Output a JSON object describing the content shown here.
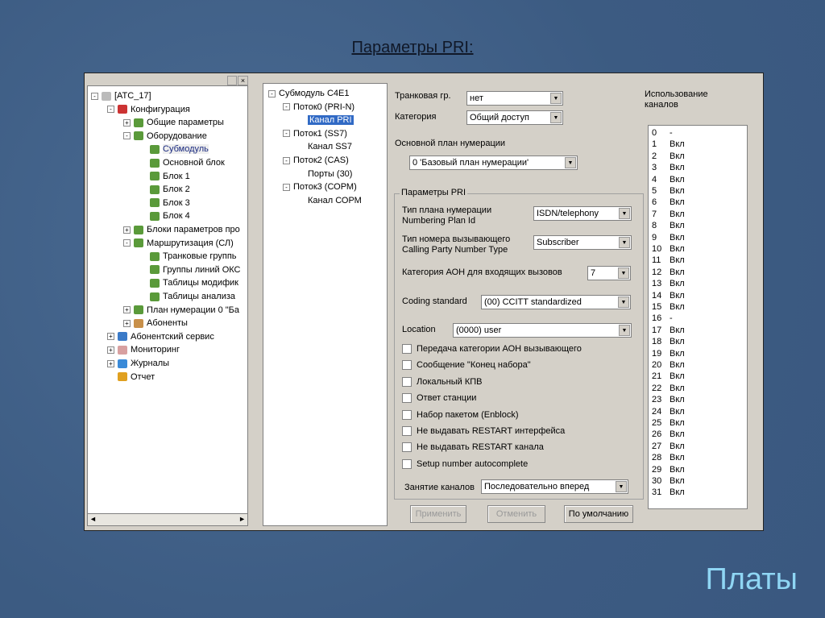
{
  "slide": {
    "title": "Параметры PRI:",
    "footer": "Платы"
  },
  "left_tree": [
    {
      "label": "[АТС_17]",
      "level": 0,
      "exp": "-",
      "icon": "phone-icon"
    },
    {
      "label": "Конфигурация",
      "level": 1,
      "exp": "-",
      "icon": "tools-icon"
    },
    {
      "label": "Общие параметры",
      "level": 2,
      "exp": "+",
      "icon": "check-icon"
    },
    {
      "label": "Оборудование",
      "level": 2,
      "exp": "-",
      "icon": "check-icon"
    },
    {
      "label": "Субмодуль",
      "level": 3,
      "exp": "",
      "icon": "check-icon",
      "selected": true
    },
    {
      "label": "Основной блок",
      "level": 3,
      "exp": "",
      "icon": "check-icon"
    },
    {
      "label": "Блок 1",
      "level": 3,
      "exp": "",
      "icon": "check-icon"
    },
    {
      "label": "Блок 2",
      "level": 3,
      "exp": "",
      "icon": "check-icon"
    },
    {
      "label": "Блок 3",
      "level": 3,
      "exp": "",
      "icon": "check-icon"
    },
    {
      "label": "Блок 4",
      "level": 3,
      "exp": "",
      "icon": "check-icon"
    },
    {
      "label": "Блоки параметров про",
      "level": 2,
      "exp": "+",
      "icon": "check-icon"
    },
    {
      "label": "Маршрутизация (СЛ)",
      "level": 2,
      "exp": "-",
      "icon": "check-icon"
    },
    {
      "label": "Транковые группь",
      "level": 3,
      "exp": "",
      "icon": "check-icon"
    },
    {
      "label": "Группы линий ОКС",
      "level": 3,
      "exp": "",
      "icon": "check-icon"
    },
    {
      "label": "Таблицы модифик",
      "level": 3,
      "exp": "",
      "icon": "check-icon"
    },
    {
      "label": "Таблицы анализа",
      "level": 3,
      "exp": "",
      "icon": "check-icon"
    },
    {
      "label": "План нумерации 0 \"Ба",
      "level": 2,
      "exp": "+",
      "icon": "check-icon"
    },
    {
      "label": "Абоненты",
      "level": 2,
      "exp": "+",
      "icon": "book-icon"
    },
    {
      "label": "Абонентский сервис",
      "level": 1,
      "exp": "+",
      "icon": "user-icon"
    },
    {
      "label": "Мониторинг",
      "level": 1,
      "exp": "+",
      "icon": "monitor-icon"
    },
    {
      "label": "Журналы",
      "level": 1,
      "exp": "+",
      "icon": "journal-icon"
    },
    {
      "label": "Отчет",
      "level": 1,
      "exp": "",
      "icon": "chart-icon"
    }
  ],
  "mid_tree": [
    {
      "label": "Субмодуль С4Е1",
      "level": 0,
      "exp": "-"
    },
    {
      "label": "Поток0 (PRI-N)",
      "level": 1,
      "exp": "-"
    },
    {
      "label": "Канал PRI",
      "level": 2,
      "exp": "",
      "selected": true
    },
    {
      "label": "Поток1 (SS7)",
      "level": 1,
      "exp": "-"
    },
    {
      "label": "Канал SS7",
      "level": 2,
      "exp": ""
    },
    {
      "label": "Поток2 (CAS)",
      "level": 1,
      "exp": "-"
    },
    {
      "label": "Порты (30)",
      "level": 2,
      "exp": ""
    },
    {
      "label": "Поток3 (СОРМ)",
      "level": 1,
      "exp": "-"
    },
    {
      "label": "Канал СОРМ",
      "level": 2,
      "exp": ""
    }
  ],
  "form": {
    "trunk_label": "Транковая гр.",
    "trunk_value": "нет",
    "category_label": "Категория",
    "category_value": "Общий доступ",
    "plan_label": "Основной план нумерации",
    "plan_value": "0 'Базовый план нумерации'",
    "group_label": "Параметры PRI",
    "npi_label1": "Тип плана нумерации",
    "npi_label2": "Numbering Plan Id",
    "npi_value": "ISDN/telephony",
    "cpnt_label1": "Тип номера вызывающего",
    "cpnt_label2": "Calling Party Number Type",
    "cpnt_value": "Subscriber",
    "aon_label": "Категория АОН для входящих вызовов",
    "aon_value": "7",
    "coding_label": "Coding standard",
    "coding_value": "(00) CCITT standardized",
    "location_label": "Location",
    "location_value": "(0000) user",
    "checkboxes": [
      "Передача категории АОН вызывающего",
      "Сообщение \"Конец набора\"",
      "Локальный КПВ",
      "Ответ станции",
      "Набор пакетом (Enblock)",
      "Не выдавать RESTART интерфейса",
      "Не выдавать RESTART канала",
      "Setup number autocomplete"
    ],
    "occupy_label": "Занятие каналов",
    "occupy_value": "Последовательно вперед",
    "apply": "Применить",
    "cancel": "Отменить",
    "default": "По умолчанию"
  },
  "channels": {
    "title1": "Использование",
    "title2": "каналов",
    "rows": [
      [
        "0",
        "-"
      ],
      [
        "1",
        "Вкл"
      ],
      [
        "2",
        "Вкл"
      ],
      [
        "3",
        "Вкл"
      ],
      [
        "4",
        "Вкл"
      ],
      [
        "5",
        "Вкл"
      ],
      [
        "6",
        "Вкл"
      ],
      [
        "7",
        "Вкл"
      ],
      [
        "8",
        "Вкл"
      ],
      [
        "9",
        "Вкл"
      ],
      [
        "10",
        "Вкл"
      ],
      [
        "11",
        "Вкл"
      ],
      [
        "12",
        "Вкл"
      ],
      [
        "13",
        "Вкл"
      ],
      [
        "14",
        "Вкл"
      ],
      [
        "15",
        "Вкл"
      ],
      [
        "16",
        "-"
      ],
      [
        "17",
        "Вкл"
      ],
      [
        "18",
        "Вкл"
      ],
      [
        "19",
        "Вкл"
      ],
      [
        "20",
        "Вкл"
      ],
      [
        "21",
        "Вкл"
      ],
      [
        "22",
        "Вкл"
      ],
      [
        "23",
        "Вкл"
      ],
      [
        "24",
        "Вкл"
      ],
      [
        "25",
        "Вкл"
      ],
      [
        "26",
        "Вкл"
      ],
      [
        "27",
        "Вкл"
      ],
      [
        "28",
        "Вкл"
      ],
      [
        "29",
        "Вкл"
      ],
      [
        "30",
        "Вкл"
      ],
      [
        "31",
        "Вкл"
      ]
    ]
  }
}
